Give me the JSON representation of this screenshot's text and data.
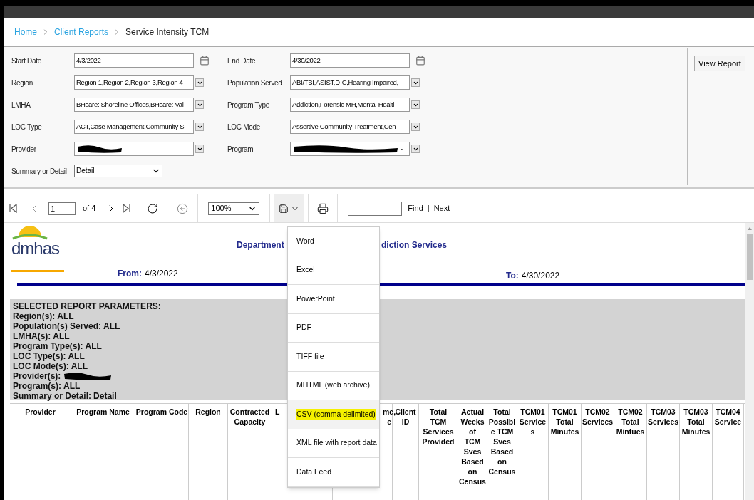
{
  "breadcrumb": [
    {
      "label": "Home",
      "link": true
    },
    {
      "label": "Client Reports",
      "link": true
    },
    {
      "label": "Service Intensity TCM",
      "link": false
    }
  ],
  "parameters_left": [
    {
      "label": "Start Date",
      "kind": "date",
      "value": "4/3/2022"
    },
    {
      "label": "Region",
      "kind": "multi",
      "value": "Region 1,Region 2,Region 3,Region 4"
    },
    {
      "label": "LMHA",
      "kind": "multi",
      "value": "BHcare: Shoreline Offices,BHcare: Val"
    },
    {
      "label": "LOC Type",
      "kind": "multi",
      "value": "ACT,Case Management,Community S"
    },
    {
      "label": "Provider",
      "kind": "redacted"
    },
    {
      "label": "Summary or Detail",
      "kind": "select",
      "value": "Detail"
    }
  ],
  "parameters_right": [
    {
      "label": "End Date",
      "kind": "date",
      "value": "4/30/2022"
    },
    {
      "label": "Population Served",
      "kind": "multi",
      "value": "ABI/TBI,ASIST,D-C,Hearing Impaired,"
    },
    {
      "label": "Program Type",
      "kind": "multi",
      "value": "Addiction,Forensic MH,Mental Healtl"
    },
    {
      "label": "LOC Mode",
      "kind": "multi",
      "value": "Assertive Community Treatment,Cen"
    },
    {
      "label": "Program",
      "kind": "redacted",
      "value": "-"
    }
  ],
  "view_button": "View Report",
  "toolbar": {
    "page": "1",
    "page_count": "of 4",
    "zoom": "100%",
    "find_label": "Find",
    "separator": "|",
    "next_label": "Next"
  },
  "export_menu": {
    "open": true,
    "items": [
      {
        "label": "Word",
        "highlighted": false
      },
      {
        "label": "Excel",
        "highlighted": false
      },
      {
        "label": "PowerPoint",
        "highlighted": false
      },
      {
        "label": "PDF",
        "highlighted": false
      },
      {
        "label": "TIFF file",
        "highlighted": false
      },
      {
        "label": "MHTML (web archive)",
        "highlighted": false
      },
      {
        "label": "CSV (comma delimited)",
        "highlighted": true
      },
      {
        "label": "XML file with report data",
        "highlighted": false
      },
      {
        "label": "Data Feed",
        "highlighted": false
      }
    ]
  },
  "report": {
    "logo": "dmhas",
    "title_left": "Department",
    "title_right": "diction Services",
    "from_label": "From:",
    "from_value": "4/3/2022",
    "to_label": "To:",
    "to_value": "4/30/2022",
    "parameters_heading": "SELECTED REPORT PARAMETERS:",
    "parameters": [
      {
        "label": "Region(s):",
        "kind": "text",
        "value": "ALL"
      },
      {
        "label": "Population(s) Served:",
        "kind": "text",
        "value": "ALL"
      },
      {
        "label": "LMHA(s):",
        "kind": "text",
        "value": "ALL"
      },
      {
        "label": "Program Type(s):",
        "kind": "text",
        "value": "ALL"
      },
      {
        "label": "LOC Type(s):",
        "kind": "text",
        "value": "ALL"
      },
      {
        "label": "LOC Mode(s):",
        "kind": "text",
        "value": "ALL"
      },
      {
        "label": "Provider(s):",
        "kind": "redacted"
      },
      {
        "label": "Program(s):",
        "kind": "text",
        "value": "ALL"
      },
      {
        "label": "Summary or Detail:",
        "kind": "text",
        "value": "Detail"
      }
    ],
    "columns": [
      "Provider",
      "Program Name",
      "Program Code",
      "Region",
      "Contracted\nCapacity",
      "L",
      "me,\ne",
      "Client\nID",
      "Total\nTCM\nServices\nProvided",
      "Actual\nWeeks\nof\nTCM\nSvcs\nBased\non\nCensus",
      "Total\nPossibl\ne TCM\nSvcs\nBased\non\nCensus",
      "TCM01\nService\ns",
      "TCM01\nTotal\nMinutes",
      "TCM02\nServices",
      "TCM02\nTotal\nMintues",
      "TCM03\nServices",
      "TCM03\nTotal\nMinutes",
      "TCM04\nService"
    ]
  }
}
